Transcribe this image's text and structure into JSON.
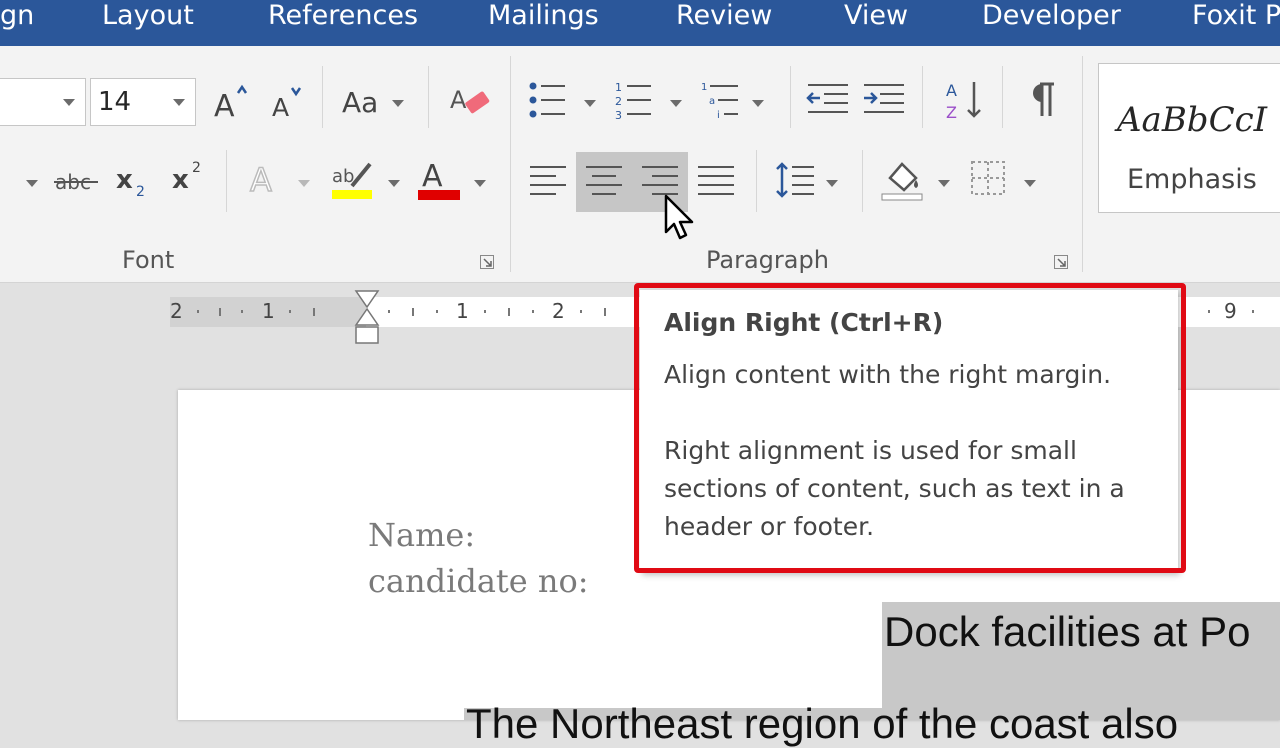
{
  "tabs": [
    {
      "label": "gn"
    },
    {
      "label": "Layout"
    },
    {
      "label": "References"
    },
    {
      "label": "Mailings"
    },
    {
      "label": "Review"
    },
    {
      "label": "View"
    },
    {
      "label": "Developer"
    },
    {
      "label": "Foxit P"
    }
  ],
  "font_group": {
    "font_name": "",
    "font_size": "14",
    "label": "Font",
    "change_case_label": "Aa",
    "buttons": [
      "grow-font",
      "shrink-font",
      "change-case",
      "clear-formatting",
      "strikethrough",
      "subscript",
      "superscript",
      "text-effects",
      "highlight",
      "font-color"
    ]
  },
  "paragraph_group": {
    "label": "Paragraph",
    "buttons": [
      "bullets",
      "numbering",
      "multilevel-list",
      "decrease-indent",
      "increase-indent",
      "sort",
      "show-hide",
      "align-left",
      "center",
      "align-right",
      "justify",
      "line-spacing",
      "shading",
      "borders"
    ],
    "hovered": "align-right"
  },
  "styles": {
    "sample": "AaBbCcI",
    "name": "Emphasis"
  },
  "ruler": {
    "numbers": [
      "2",
      "1",
      "1",
      "2",
      "9"
    ]
  },
  "colors": {
    "tab_bar": "#2b579a",
    "highlight": "#ffff00",
    "font_color": "#e00000",
    "callout": "#e00a14"
  },
  "tooltip": {
    "title": "Align Right (Ctrl+R)",
    "line1": "Align content with the right margin.",
    "line2": "Right alignment is used for small",
    "line3": "sections of content, such as text in a",
    "line4": "header or footer."
  },
  "document": {
    "name_label": "Name:",
    "candidate_label": "candidate no:",
    "title": "Dock facilities at Po",
    "body_start": "The Northeast region of the coast also"
  }
}
